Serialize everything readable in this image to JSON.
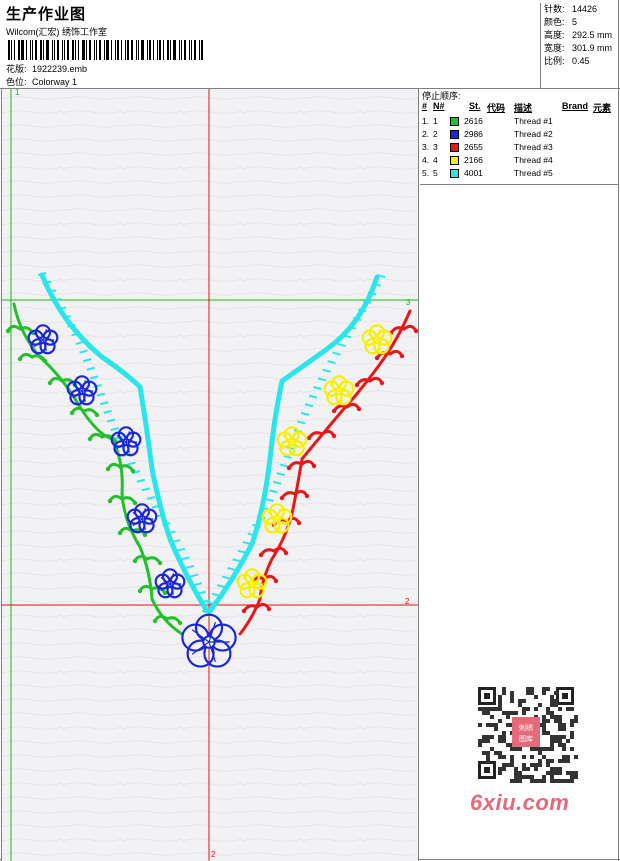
{
  "header": {
    "title": "生产作业图",
    "company": "Wilcom(汇宏) 绣饰工作室",
    "pattern_label": "花版:",
    "pattern_value": "1922239.emb",
    "colorway_label": "色位:",
    "colorway_value": "Colorway 1"
  },
  "info": {
    "stitches_label": "针数:",
    "stitches_value": "14426",
    "colors_label": "颜色:",
    "colors_value": "5",
    "height_label": "高度:",
    "height_value": "292.5 mm",
    "width_label": "宽度:",
    "width_value": "301.9 mm",
    "scale_label": "比例:",
    "scale_value": "0.45"
  },
  "stop_sequence": {
    "title": "停止顺序:",
    "columns": {
      "num": "#",
      "n": "N#",
      "st": "St.",
      "code": "代码",
      "desc": "描述",
      "brand": "Brand",
      "element": "元素"
    },
    "rows": [
      {
        "num": "1.",
        "n": "1",
        "color": "#22c02a",
        "code": "2616",
        "desc": "Thread #1"
      },
      {
        "num": "2.",
        "n": "2",
        "color": "#1a28d8",
        "code": "2986",
        "desc": "Thread #2"
      },
      {
        "num": "3.",
        "n": "3",
        "color": "#e81818",
        "code": "2655",
        "desc": "Thread #3"
      },
      {
        "num": "4.",
        "n": "4",
        "color": "#f6f000",
        "code": "2166",
        "desc": "Thread #4"
      },
      {
        "num": "5.",
        "n": "5",
        "color": "#2ae6ea",
        "code": "4001",
        "desc": "Thread #5"
      }
    ]
  },
  "guides": {
    "top_left": "1",
    "right_mid": "2",
    "bottom": "2",
    "right_top": "3"
  },
  "watermark": "6xiu.com",
  "qr_badge": "刺绣图库",
  "colors": {
    "green": "#22c02a",
    "blue": "#1a28d8",
    "red": "#e81818",
    "yellow": "#f6f000",
    "cyan": "#2ae6ea",
    "guide_red": "#e01010",
    "guide_green": "#10c010"
  }
}
